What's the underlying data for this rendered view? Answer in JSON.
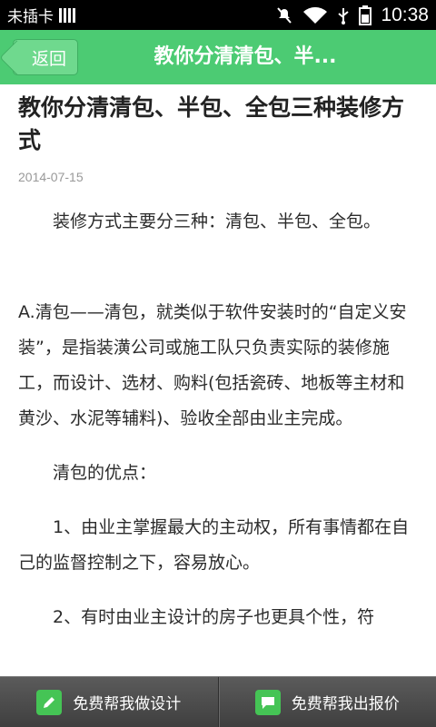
{
  "status_bar": {
    "carrier": "未插卡",
    "time": "10:38",
    "icons": [
      "signal-icon",
      "mute-icon",
      "wifi-icon",
      "usb-icon",
      "battery-icon"
    ]
  },
  "header": {
    "back_label": "返回",
    "title": "教你分清清包、半..."
  },
  "article": {
    "title": "教你分清清包、半包、全包三种装修方式",
    "date": "2014-07-15",
    "paragraphs": [
      "装修方式主要分三种：清包、半包、全包。",
      "A.清包——清包，就类似于软件安装时的“自定义安装”，是指装潢公司或施工队只负责实际的装修施工，而设计、选材、购料(包括瓷砖、地板等主材和黄沙、水泥等辅料)、验收全部由业主完成。",
      "清包的优点：",
      "1、由业主掌握最大的主动权，所有事情都在自己的监督控制之下，容易放心。",
      "2、有时由业主设计的房子也更具个性，符"
    ]
  },
  "bottom_bar": {
    "design_label": "免费帮我做设计",
    "quote_label": "免费帮我出报价",
    "accent_color": "#45c455"
  },
  "colors": {
    "header_bg": "#4ccb73",
    "status_bg": "#000000",
    "bottom_bg": "#4a4a4a"
  }
}
